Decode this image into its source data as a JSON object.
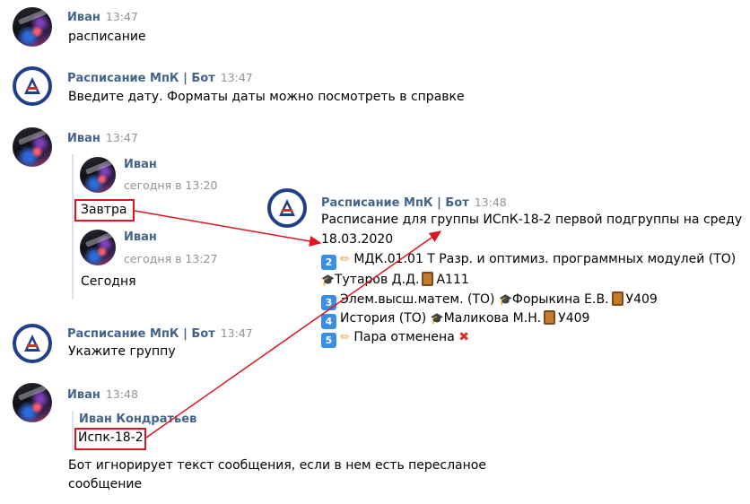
{
  "messages": {
    "m1": {
      "author": "Иван",
      "time": "13:47",
      "text": "расписание"
    },
    "m2": {
      "author": "Расписание МпК | Бот",
      "time": "13:47",
      "text": "Введите дату. Форматы даты можно посмотреть в справке"
    },
    "m3": {
      "author": "Иван",
      "time": "13:47",
      "fwd1": {
        "author": "Иван",
        "time": "сегодня в 13:20",
        "text": "Завтра"
      },
      "fwd2": {
        "author": "Иван",
        "time": "сегодня в 13:27",
        "text": "Сегодня"
      }
    },
    "m4": {
      "author": "Расписание МпК | Бот",
      "time": "13:48",
      "line1": "Расписание для группы ИСпК-18-2 первой подгруппы на среду",
      "line2": "18.03.2020",
      "l1_num": "2",
      "l1_text": "МДК.01.01 Т Разр. и оптимиз. программных модулей (ТО)",
      "l1_teacher": "Тутаров Д.Д.",
      "l1_room": "А111",
      "l2_num": "3",
      "l2_text": "Элем.высш.матем. (ТО)",
      "l2_teacher": "Форыкина Е.В.",
      "l2_room": "У409",
      "l3_num": "4",
      "l3_text": "История (ТО)",
      "l3_teacher": "Маликова М.Н.",
      "l3_room": "У409",
      "l4_num": "5",
      "l4_text": "Пара отменена"
    },
    "m5": {
      "author": "Расписание МпК | Бот",
      "time": "13:47",
      "text": "Укажите группу"
    },
    "m6": {
      "author": "Иван",
      "time": "13:48",
      "fwd": {
        "author": "Иван Кондратьев",
        "text": "Испк-18-2"
      },
      "text1": "Бот игнорирует текст сообщения, если в нем есть пересланое",
      "text2": "сообщение"
    }
  },
  "icons": {
    "pencil": "✏",
    "cap": "🎓",
    "cross": "✖"
  },
  "colors": {
    "name": "#42648b",
    "time": "#939393",
    "highlight": "#e0141f",
    "keycap": "#3a8ee6"
  }
}
